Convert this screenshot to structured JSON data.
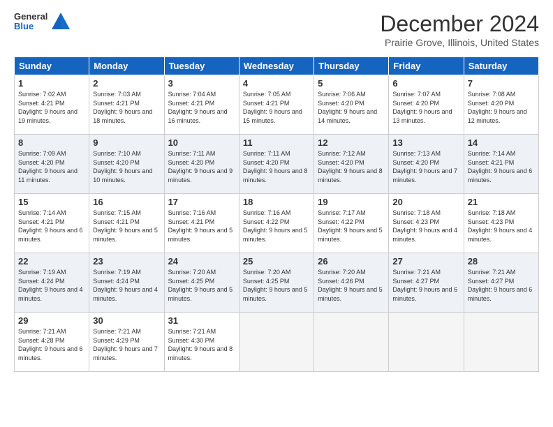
{
  "header": {
    "logo_general": "General",
    "logo_blue": "Blue",
    "title": "December 2024",
    "location": "Prairie Grove, Illinois, United States"
  },
  "days_of_week": [
    "Sunday",
    "Monday",
    "Tuesday",
    "Wednesday",
    "Thursday",
    "Friday",
    "Saturday"
  ],
  "weeks": [
    [
      {
        "day": "1",
        "sunrise": "7:02 AM",
        "sunset": "4:21 PM",
        "daylight": "9 hours and 19 minutes."
      },
      {
        "day": "2",
        "sunrise": "7:03 AM",
        "sunset": "4:21 PM",
        "daylight": "9 hours and 18 minutes."
      },
      {
        "day": "3",
        "sunrise": "7:04 AM",
        "sunset": "4:21 PM",
        "daylight": "9 hours and 16 minutes."
      },
      {
        "day": "4",
        "sunrise": "7:05 AM",
        "sunset": "4:21 PM",
        "daylight": "9 hours and 15 minutes."
      },
      {
        "day": "5",
        "sunrise": "7:06 AM",
        "sunset": "4:20 PM",
        "daylight": "9 hours and 14 minutes."
      },
      {
        "day": "6",
        "sunrise": "7:07 AM",
        "sunset": "4:20 PM",
        "daylight": "9 hours and 13 minutes."
      },
      {
        "day": "7",
        "sunrise": "7:08 AM",
        "sunset": "4:20 PM",
        "daylight": "9 hours and 12 minutes."
      }
    ],
    [
      {
        "day": "8",
        "sunrise": "7:09 AM",
        "sunset": "4:20 PM",
        "daylight": "9 hours and 11 minutes."
      },
      {
        "day": "9",
        "sunrise": "7:10 AM",
        "sunset": "4:20 PM",
        "daylight": "9 hours and 10 minutes."
      },
      {
        "day": "10",
        "sunrise": "7:11 AM",
        "sunset": "4:20 PM",
        "daylight": "9 hours and 9 minutes."
      },
      {
        "day": "11",
        "sunrise": "7:11 AM",
        "sunset": "4:20 PM",
        "daylight": "9 hours and 8 minutes."
      },
      {
        "day": "12",
        "sunrise": "7:12 AM",
        "sunset": "4:20 PM",
        "daylight": "9 hours and 8 minutes."
      },
      {
        "day": "13",
        "sunrise": "7:13 AM",
        "sunset": "4:20 PM",
        "daylight": "9 hours and 7 minutes."
      },
      {
        "day": "14",
        "sunrise": "7:14 AM",
        "sunset": "4:21 PM",
        "daylight": "9 hours and 6 minutes."
      }
    ],
    [
      {
        "day": "15",
        "sunrise": "7:14 AM",
        "sunset": "4:21 PM",
        "daylight": "9 hours and 6 minutes."
      },
      {
        "day": "16",
        "sunrise": "7:15 AM",
        "sunset": "4:21 PM",
        "daylight": "9 hours and 5 minutes."
      },
      {
        "day": "17",
        "sunrise": "7:16 AM",
        "sunset": "4:21 PM",
        "daylight": "9 hours and 5 minutes."
      },
      {
        "day": "18",
        "sunrise": "7:16 AM",
        "sunset": "4:22 PM",
        "daylight": "9 hours and 5 minutes."
      },
      {
        "day": "19",
        "sunrise": "7:17 AM",
        "sunset": "4:22 PM",
        "daylight": "9 hours and 5 minutes."
      },
      {
        "day": "20",
        "sunrise": "7:18 AM",
        "sunset": "4:23 PM",
        "daylight": "9 hours and 4 minutes."
      },
      {
        "day": "21",
        "sunrise": "7:18 AM",
        "sunset": "4:23 PM",
        "daylight": "9 hours and 4 minutes."
      }
    ],
    [
      {
        "day": "22",
        "sunrise": "7:19 AM",
        "sunset": "4:24 PM",
        "daylight": "9 hours and 4 minutes."
      },
      {
        "day": "23",
        "sunrise": "7:19 AM",
        "sunset": "4:24 PM",
        "daylight": "9 hours and 4 minutes."
      },
      {
        "day": "24",
        "sunrise": "7:20 AM",
        "sunset": "4:25 PM",
        "daylight": "9 hours and 5 minutes."
      },
      {
        "day": "25",
        "sunrise": "7:20 AM",
        "sunset": "4:25 PM",
        "daylight": "9 hours and 5 minutes."
      },
      {
        "day": "26",
        "sunrise": "7:20 AM",
        "sunset": "4:26 PM",
        "daylight": "9 hours and 5 minutes."
      },
      {
        "day": "27",
        "sunrise": "7:21 AM",
        "sunset": "4:27 PM",
        "daylight": "9 hours and 6 minutes."
      },
      {
        "day": "28",
        "sunrise": "7:21 AM",
        "sunset": "4:27 PM",
        "daylight": "9 hours and 6 minutes."
      }
    ],
    [
      {
        "day": "29",
        "sunrise": "7:21 AM",
        "sunset": "4:28 PM",
        "daylight": "9 hours and 6 minutes."
      },
      {
        "day": "30",
        "sunrise": "7:21 AM",
        "sunset": "4:29 PM",
        "daylight": "9 hours and 7 minutes."
      },
      {
        "day": "31",
        "sunrise": "7:21 AM",
        "sunset": "4:30 PM",
        "daylight": "9 hours and 8 minutes."
      },
      null,
      null,
      null,
      null
    ]
  ]
}
